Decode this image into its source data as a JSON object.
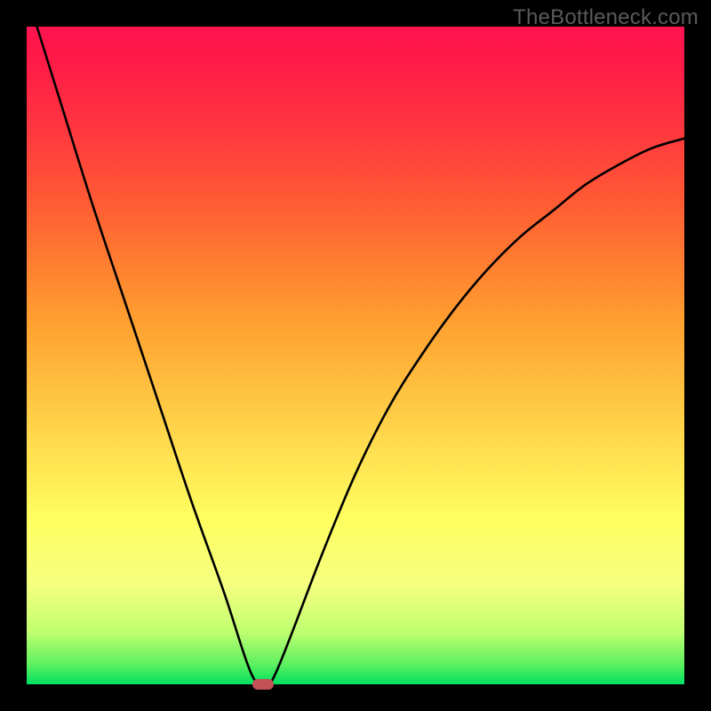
{
  "watermark": "TheBottleneck.com",
  "chart_data": {
    "type": "line",
    "title": "",
    "xlabel": "",
    "ylabel": "",
    "xlim": [
      0,
      100
    ],
    "ylim": [
      0,
      100
    ],
    "series": [
      {
        "name": "curve",
        "x": [
          0,
          5,
          10,
          15,
          20,
          25,
          30,
          34,
          36,
          38,
          45,
          50,
          55,
          60,
          65,
          70,
          75,
          80,
          85,
          90,
          95,
          100
        ],
        "y": [
          105,
          89,
          73,
          58,
          43,
          28,
          14,
          2,
          0,
          2,
          20,
          32,
          42,
          50,
          57,
          63,
          68,
          72,
          76,
          79,
          81.5,
          83
        ]
      }
    ],
    "marker": {
      "x": 36,
      "y": 0,
      "shape": "pill",
      "color": "#c25257"
    },
    "gradient_colors_top_to_bottom": [
      "#ff1450",
      "#ffa030",
      "#ffff60",
      "#00e060"
    ]
  }
}
